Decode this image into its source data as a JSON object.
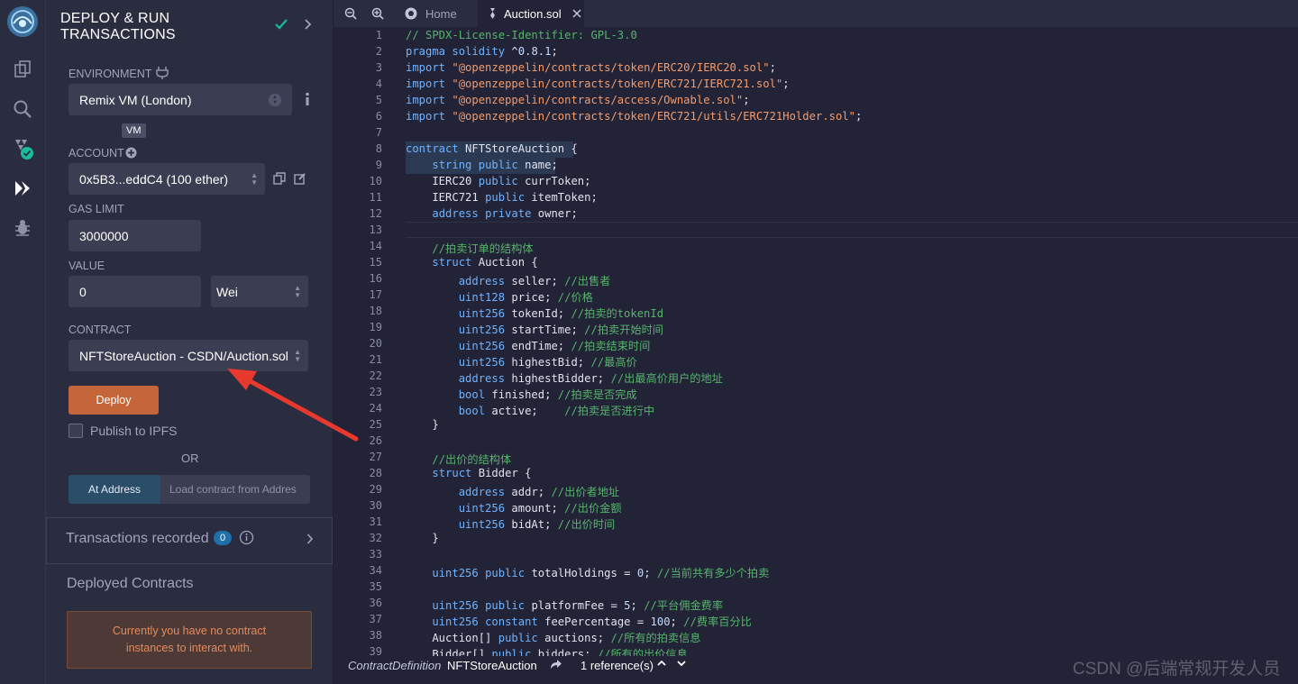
{
  "rail": {
    "icons": [
      "remix-logo-icon",
      "file-explorer-icon",
      "search-icon",
      "solidity-compiler-icon",
      "deploy-run-icon",
      "debugger-icon"
    ]
  },
  "panel": {
    "title_line1": "DEPLOY & RUN",
    "title_line2": "TRANSACTIONS",
    "environment_label": "ENVIRONMENT",
    "environment_value": "Remix VM (London)",
    "vm_badge": "VM",
    "account_label": "ACCOUNT",
    "account_value": "0x5B3...eddC4 (100 ether)",
    "gas_limit_label": "GAS LIMIT",
    "gas_limit_value": "3000000",
    "value_label": "VALUE",
    "value_value": "0",
    "value_unit": "Wei",
    "contract_label": "CONTRACT",
    "contract_value": "NFTStoreAuction - CSDN/Auction.sol",
    "deploy_label": "Deploy",
    "publish_label": "Publish to IPFS",
    "or_label": "OR",
    "at_address_label": "At Address",
    "load_contract_placeholder": "Load contract from Addres",
    "transactions_recorded_label": "Transactions recorded",
    "transactions_recorded_count": "0",
    "deployed_contracts_label": "Deployed Contracts",
    "no_contract_msg_line1": "Currently you have no contract",
    "no_contract_msg_line2": "instances to interact with."
  },
  "tabs": {
    "home_label": "Home",
    "file_label": "Auction.sol"
  },
  "editor": {
    "lines": [
      {
        "n": "1",
        "t": "// SPDX-License-Identifier: GPL-3.0"
      },
      {
        "n": "2",
        "t": "pragma solidity ^0.8.1;"
      },
      {
        "n": "3",
        "t": "import \"@openzeppelin/contracts/token/ERC20/IERC20.sol\";"
      },
      {
        "n": "4",
        "t": "import \"@openzeppelin/contracts/token/ERC721/IERC721.sol\";"
      },
      {
        "n": "5",
        "t": "import \"@openzeppelin/contracts/access/Ownable.sol\";"
      },
      {
        "n": "6",
        "t": "import \"@openzeppelin/contracts/token/ERC721/utils/ERC721Holder.sol\";"
      },
      {
        "n": "7",
        "t": ""
      },
      {
        "n": "8",
        "t": "contract NFTStoreAuction {"
      },
      {
        "n": "9",
        "t": "    string public name;"
      },
      {
        "n": "10",
        "t": "    IERC20 public currToken;"
      },
      {
        "n": "11",
        "t": "    IERC721 public itemToken;"
      },
      {
        "n": "12",
        "t": "    address private owner;"
      },
      {
        "n": "13",
        "t": ""
      },
      {
        "n": "14",
        "t": "    //拍卖订单的结构体"
      },
      {
        "n": "15",
        "t": "    struct Auction {"
      },
      {
        "n": "16",
        "t": "        address seller; //出售者"
      },
      {
        "n": "17",
        "t": "        uint128 price; //价格"
      },
      {
        "n": "18",
        "t": "        uint256 tokenId; //拍卖的tokenId"
      },
      {
        "n": "19",
        "t": "        uint256 startTime; //拍卖开始时间"
      },
      {
        "n": "20",
        "t": "        uint256 endTime; //拍卖结束时间"
      },
      {
        "n": "21",
        "t": "        uint256 highestBid; //最高价"
      },
      {
        "n": "22",
        "t": "        address highestBidder; //出最高价用户的地址"
      },
      {
        "n": "23",
        "t": "        bool finished; //拍卖是否完成"
      },
      {
        "n": "24",
        "t": "        bool active;    //拍卖是否进行中"
      },
      {
        "n": "25",
        "t": "    }"
      },
      {
        "n": "26",
        "t": ""
      },
      {
        "n": "27",
        "t": "    //出价的结构体"
      },
      {
        "n": "28",
        "t": "    struct Bidder {"
      },
      {
        "n": "29",
        "t": "        address addr; //出价者地址"
      },
      {
        "n": "30",
        "t": "        uint256 amount; //出价金额"
      },
      {
        "n": "31",
        "t": "        uint256 bidAt; //出价时间"
      },
      {
        "n": "32",
        "t": "    }"
      },
      {
        "n": "33",
        "t": ""
      },
      {
        "n": "34",
        "t": "    uint256 public totalHoldings = 0; //当前共有多少个拍卖"
      },
      {
        "n": "35",
        "t": ""
      },
      {
        "n": "36",
        "t": "    uint256 public platformFee = 5; //平台佣金费率"
      },
      {
        "n": "37",
        "t": "    uint256 constant feePercentage = 100; //费率百分比"
      },
      {
        "n": "38",
        "t": "    Auction[] public auctions; //所有的拍卖信息"
      },
      {
        "n": "39",
        "t": "    Bidder[] public bidders; //所有的出价信息"
      }
    ]
  },
  "status": {
    "definition_kind": "ContractDefinition",
    "definition_name": "NFTStoreAuction",
    "references": "1 reference(s)"
  },
  "watermark": "CSDN @后端常规开发人员",
  "colors": {
    "accent_orange": "#c4663a",
    "check_green": "#1bbc9b",
    "at_address_blue": "#2b4e68",
    "arrow_red": "#e8392f"
  }
}
